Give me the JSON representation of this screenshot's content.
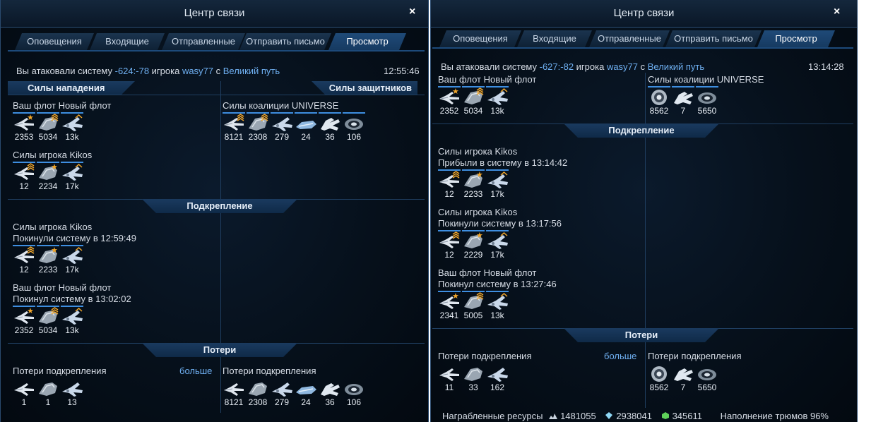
{
  "left": {
    "window_title": "Центр связи",
    "close": "×",
    "tabs": [
      "Оповещения",
      "Входящие",
      "Отправленные",
      "Отправить письмо",
      "Просмотр"
    ],
    "active_tab": "Просмотр",
    "headline": {
      "pre": "Вы атаковали систему ",
      "coords": "-624:-78",
      "mid": " игрока ",
      "player": "wasy77",
      "with": " с ",
      "fleet": "Великий путь"
    },
    "time": "12:55:46",
    "attack_header": "Силы нападения",
    "defense_header": "Силы защитников",
    "attack_fleets": [
      {
        "title": "Ваш флот Новый флот",
        "ships": [
          {
            "icon": "fighter-icon",
            "rank": "★",
            "count": "2353"
          },
          {
            "icon": "cruiser-icon",
            "rank": "chevron",
            "count": "5034"
          },
          {
            "icon": "bomber-icon",
            "rank": "chevron1",
            "count": "13k"
          }
        ]
      },
      {
        "title": "Силы игрока Kikos",
        "ships": [
          {
            "icon": "fighter-icon",
            "rank": "chevron",
            "count": "12"
          },
          {
            "icon": "cruiser-icon",
            "rank": "★",
            "count": "2234"
          },
          {
            "icon": "bomber-icon",
            "rank": "chevron1",
            "count": "17k"
          }
        ]
      }
    ],
    "defense_fleets": [
      {
        "title": "Силы коалиции UNIVERSE",
        "ships": [
          {
            "icon": "fighter-icon",
            "rank": "chevron",
            "count": "8121"
          },
          {
            "icon": "cruiser-icon",
            "rank": "chevron",
            "count": "2308"
          },
          {
            "icon": "bomber-icon",
            "rank": "",
            "count": "279"
          },
          {
            "icon": "corvette-icon",
            "rank": "",
            "count": "24"
          },
          {
            "icon": "claw-icon",
            "rank": "",
            "count": "36"
          },
          {
            "icon": "station-icon",
            "rank": "",
            "count": "106"
          }
        ]
      }
    ],
    "reinforcement_header": "Подкрепление",
    "reinforcements": [
      {
        "title": "Силы игрока Kikos",
        "subtitle": "Покинули систему в 12:59:49",
        "ships": [
          {
            "icon": "fighter-icon",
            "rank": "chevron",
            "count": "12"
          },
          {
            "icon": "cruiser-icon",
            "rank": "★",
            "count": "2233"
          },
          {
            "icon": "bomber-icon",
            "rank": "chevron1",
            "count": "17k"
          }
        ]
      },
      {
        "title": "Ваш флот Новый флот",
        "subtitle": "Покинул систему в 13:02:02",
        "ships": [
          {
            "icon": "fighter-icon",
            "rank": "★",
            "count": "2352"
          },
          {
            "icon": "cruiser-icon",
            "rank": "chevron",
            "count": "5034"
          },
          {
            "icon": "bomber-icon",
            "rank": "chevron1",
            "count": "13k"
          }
        ]
      }
    ],
    "losses_header": "Потери",
    "losses_left": {
      "title": "Потери подкрепления",
      "more": "больше",
      "ships": [
        {
          "icon": "fighter-icon",
          "count": "1"
        },
        {
          "icon": "cruiser-icon",
          "count": "1"
        },
        {
          "icon": "bomber-icon",
          "count": "13"
        }
      ]
    },
    "losses_right": {
      "title": "Потери подкрепления",
      "ships": [
        {
          "icon": "fighter-icon",
          "count": "8121"
        },
        {
          "icon": "cruiser-icon",
          "count": "2308"
        },
        {
          "icon": "bomber-icon",
          "count": "279"
        },
        {
          "icon": "corvette-icon",
          "count": "24"
        },
        {
          "icon": "claw-icon",
          "count": "36"
        },
        {
          "icon": "station-icon",
          "count": "106"
        }
      ]
    }
  },
  "right": {
    "window_title": "Центр связи",
    "close": "×",
    "tabs": [
      "Оповещения",
      "Входящие",
      "Отправленные",
      "Отправить письмо",
      "Просмотр"
    ],
    "active_tab": "Просмотр",
    "headline": {
      "pre": "Вы атаковали систему ",
      "coords": "-627:-82",
      "mid": " игрока ",
      "player": "wasy77",
      "with": " с ",
      "fleet": "Великий путь"
    },
    "time": "13:14:28",
    "attack_fleets": [
      {
        "title": "Ваш флот Новый флот",
        "ships": [
          {
            "icon": "fighter-icon",
            "rank": "★",
            "count": "2352"
          },
          {
            "icon": "cruiser-icon",
            "rank": "chevron",
            "count": "5034"
          },
          {
            "icon": "bomber-icon",
            "rank": "chevron1",
            "count": "13k"
          }
        ]
      }
    ],
    "defense_fleets": [
      {
        "title": "Силы коалиции UNIVERSE",
        "ships": [
          {
            "icon": "ring-icon",
            "rank": "",
            "count": "8562"
          },
          {
            "icon": "claw-icon",
            "rank": "",
            "count": "7"
          },
          {
            "icon": "station-icon",
            "rank": "",
            "count": "5650"
          }
        ]
      }
    ],
    "reinforcement_header": "Подкрепление",
    "reinforcements": [
      {
        "title": "Силы игрока Kikos",
        "subtitle": "Прибыли в систему в 13:14:42",
        "ships": [
          {
            "icon": "fighter-icon",
            "rank": "chevron",
            "count": "12"
          },
          {
            "icon": "cruiser-icon",
            "rank": "★",
            "count": "2233"
          },
          {
            "icon": "bomber-icon",
            "rank": "chevron1",
            "count": "17k"
          }
        ]
      },
      {
        "title": "Силы игрока Kikos",
        "subtitle": "Покинули систему в 13:17:56",
        "ships": [
          {
            "icon": "fighter-icon",
            "rank": "chevron",
            "count": "12"
          },
          {
            "icon": "cruiser-icon",
            "rank": "★",
            "count": "2229"
          },
          {
            "icon": "bomber-icon",
            "rank": "chevron1",
            "count": "17k"
          }
        ]
      },
      {
        "title": "Ваш флот Новый флот",
        "subtitle": "Покинул систему в 13:27:46",
        "ships": [
          {
            "icon": "fighter-icon",
            "rank": "★",
            "count": "2341"
          },
          {
            "icon": "cruiser-icon",
            "rank": "chevron",
            "count": "5005"
          },
          {
            "icon": "bomber-icon",
            "rank": "chevron1",
            "count": "13k"
          }
        ]
      }
    ],
    "losses_header": "Потери",
    "losses_left": {
      "title": "Потери подкрепления",
      "more": "больше",
      "ships": [
        {
          "icon": "fighter-icon",
          "count": "11"
        },
        {
          "icon": "cruiser-icon",
          "count": "33"
        },
        {
          "icon": "bomber-icon",
          "count": "162"
        }
      ]
    },
    "losses_right": {
      "title": "Потери подкрепления",
      "ships": [
        {
          "icon": "ring-icon",
          "count": "8562"
        },
        {
          "icon": "claw-icon",
          "count": "7"
        },
        {
          "icon": "station-icon",
          "count": "5650"
        }
      ]
    },
    "footer": {
      "plunder_label": "Награбленные ресурсы",
      "metal": "1481055",
      "crystal": "2938041",
      "gas": "345611",
      "cargo": "Наполнение трюмов 96%"
    }
  }
}
